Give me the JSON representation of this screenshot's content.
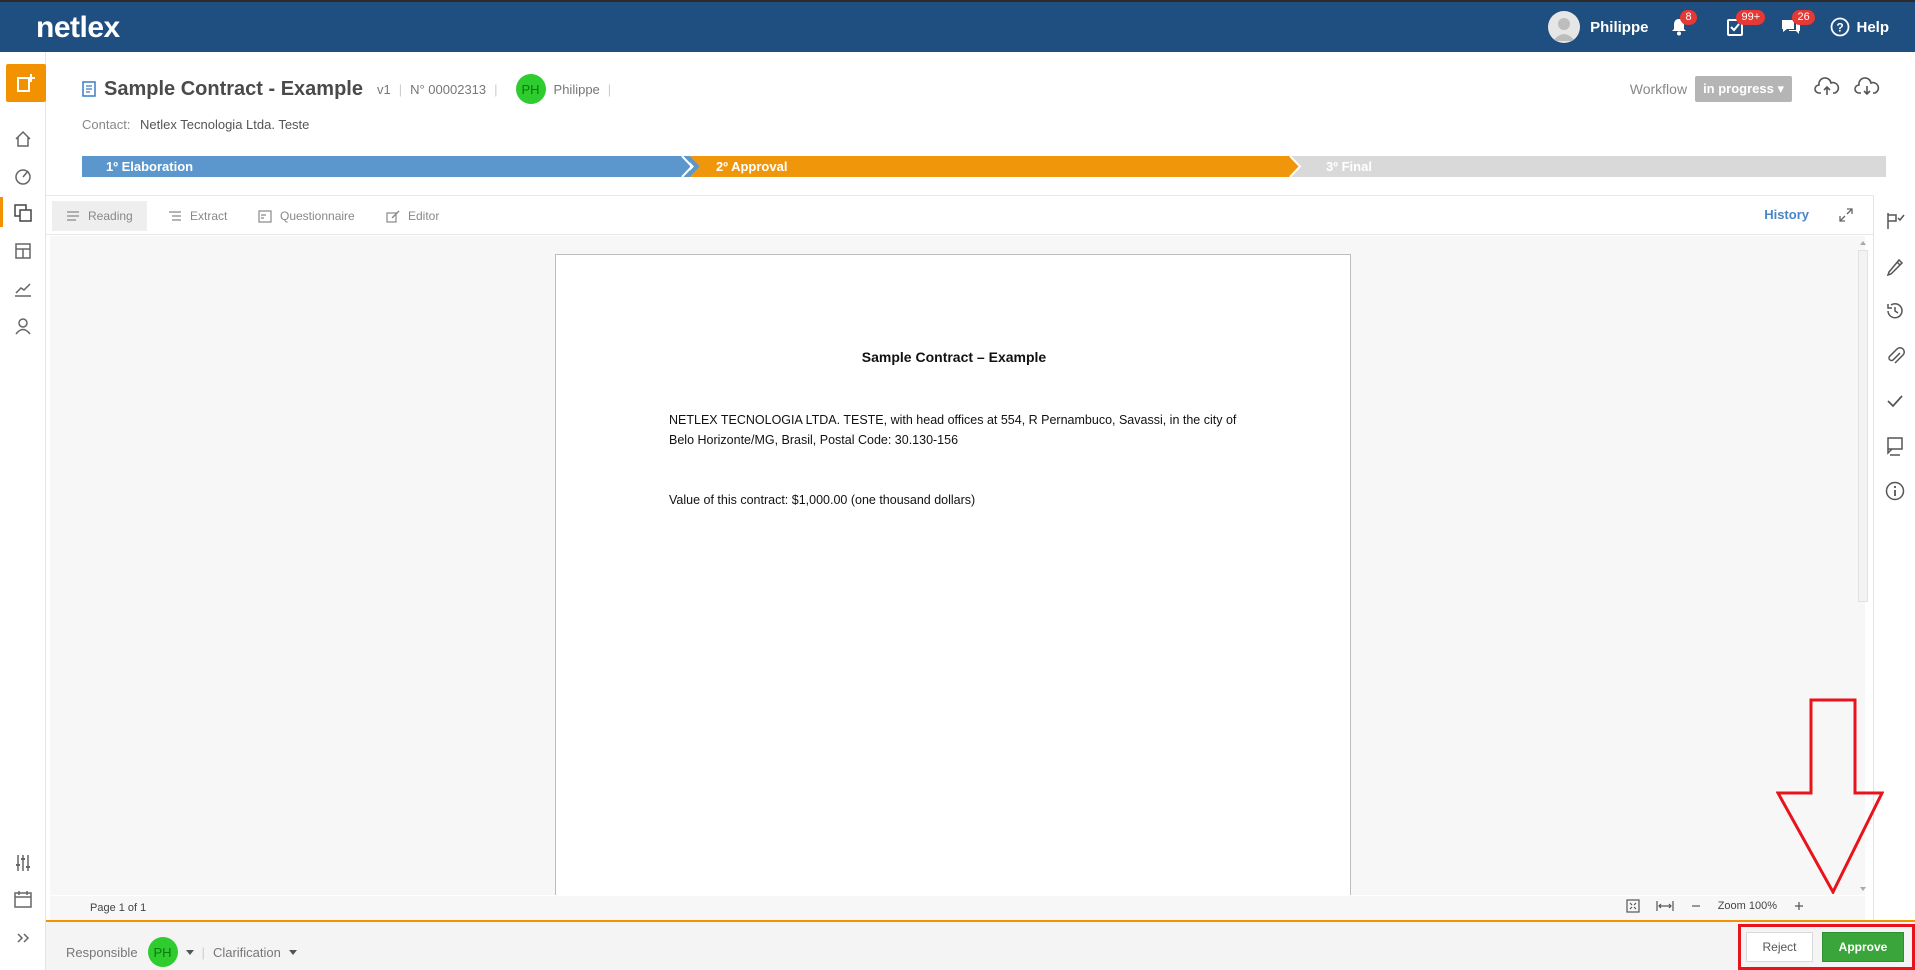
{
  "app": {
    "logo": "netlex",
    "user_name": "Philippe",
    "notifications_count": "8",
    "tasks_count": "99+",
    "messages_count": "26",
    "help_label": "Help"
  },
  "document": {
    "title": "Sample Contract - Example",
    "version": "v1",
    "number": "N° 00002313",
    "owner_initials": "PH",
    "owner_name": "Philippe",
    "contact_label": "Contact:",
    "contact_value": "Netlex Tecnologia Ltda. Teste",
    "workflow_label": "Workflow",
    "workflow_status": "in progress"
  },
  "stages": [
    {
      "label": "1º Elaboration",
      "color": "#5b97cc"
    },
    {
      "label": "2º Approval",
      "color": "#f0960a"
    },
    {
      "label": "3º Final",
      "color": "#d9d9d9"
    }
  ],
  "tabs": {
    "reading": "Reading",
    "extract": "Extract",
    "questionnaire": "Questionnaire",
    "editor": "Editor",
    "history": "History"
  },
  "paper": {
    "title": "Sample Contract – Example",
    "paragraph1_line1": "NETLEX TECNOLOGIA LTDA. TESTE, with head offices at 554, R Pernambuco, Savassi, in the city of",
    "paragraph1_line2": "Belo Horizonte/MG, Brasil, Postal Code: 30.130-156",
    "paragraph2": "Value of this contract: $1,000.00 (one thousand dollars)"
  },
  "pagebar": {
    "page_info": "Page 1 of 1",
    "zoom_label": "Zoom 100%"
  },
  "footer": {
    "responsible_label": "Responsible",
    "responsible_initials": "PH",
    "clarification_label": "Clarification",
    "reject_label": "Reject",
    "approve_label": "Approve"
  },
  "colors": {
    "topbar": "#1e4f80",
    "accent": "#f39200",
    "approve": "#3aa53a",
    "annotation": "#e8141c"
  }
}
